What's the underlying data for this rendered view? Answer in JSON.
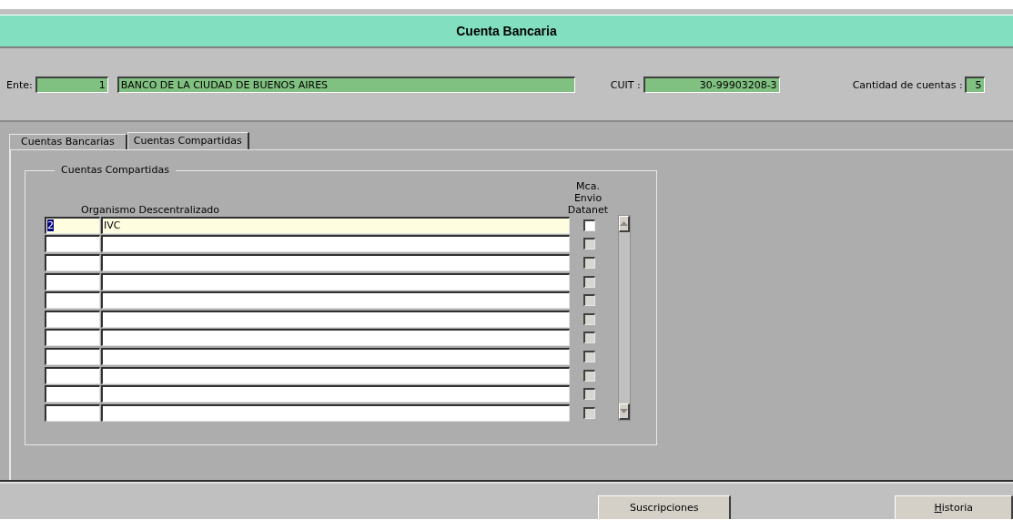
{
  "window": {
    "title": "Cuenta Bancaria"
  },
  "header": {
    "ente_label": "Ente:",
    "ente_code": "1",
    "ente_name": "BANCO DE LA CIUDAD DE BUENOS AIRES",
    "cuit_label": "CUIT :",
    "cuit": "30-99903208-3",
    "count_label": "Cantidad de cuentas :",
    "count": "5"
  },
  "tabs": [
    {
      "label": "Cuentas Bancarias",
      "selected": false
    },
    {
      "label": "Cuentas Compartidas",
      "selected": true
    }
  ],
  "group": {
    "title": "Cuentas Compartidas",
    "columns": {
      "name": "Organismo Descentralizado",
      "datanet": "Mca. Envio Datanet"
    },
    "rows": [
      {
        "code": "2",
        "code_selected": true,
        "name": "IVC",
        "current": true,
        "datanet": {
          "checked": false,
          "disabled": false
        }
      },
      {
        "current": false,
        "datanet": {
          "checked": false,
          "disabled": true
        }
      },
      {
        "current": false,
        "datanet": {
          "checked": false,
          "disabled": true
        }
      },
      {
        "current": false,
        "datanet": {
          "checked": false,
          "disabled": true
        }
      },
      {
        "current": false,
        "datanet": {
          "checked": false,
          "disabled": true
        }
      },
      {
        "current": false,
        "datanet": {
          "checked": false,
          "disabled": true
        }
      },
      {
        "current": false,
        "datanet": {
          "checked": false,
          "disabled": true
        }
      },
      {
        "current": false,
        "datanet": {
          "checked": false,
          "disabled": true
        }
      },
      {
        "current": false,
        "datanet": {
          "checked": false,
          "disabled": true
        }
      },
      {
        "current": false,
        "datanet": {
          "checked": false,
          "disabled": true
        }
      },
      {
        "current": false,
        "datanet": {
          "checked": false,
          "disabled": true
        }
      }
    ]
  },
  "buttons": [
    {
      "label": "Suscripciones",
      "mnemonic": false
    },
    {
      "label": "Historia",
      "mnemonic": true
    }
  ]
}
